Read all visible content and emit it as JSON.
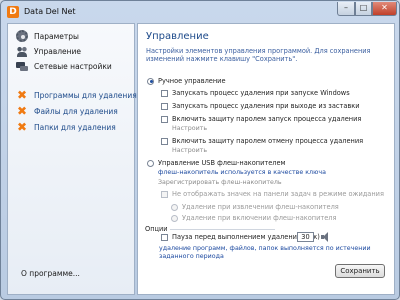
{
  "window": {
    "title": "Data Del Net",
    "app_icon": "D",
    "close_glyph": "✕",
    "max_glyph": "□",
    "min_glyph": "–"
  },
  "sidebar": {
    "items": [
      {
        "label": "Параметры",
        "icon": "gear-icon"
      },
      {
        "label": "Управление",
        "icon": "users-icon"
      },
      {
        "label": "Сетевые настройки",
        "icon": "network-icon"
      },
      {
        "label": "Программы для удаления",
        "icon": "x-icon"
      },
      {
        "label": "Файлы для удаления",
        "icon": "x-icon"
      },
      {
        "label": "Папки для удаления",
        "icon": "x-icon"
      }
    ],
    "about": "О программе...",
    "x_glyph": "✖"
  },
  "main": {
    "title": "Управление",
    "description": "Настройки элементов управления программой. Для сохранения изменений нажмите клавишу \"Сохранить\".",
    "manual": {
      "label": "Ручное управление",
      "selected": true,
      "options": [
        "Запускать процесс удаления при запуске Windows",
        "Запускать процесс удаления при выходе из заставки",
        "Включить защиту паролем запуск процесса удаления",
        "Включить защиту паролем отмену процесса удаления"
      ],
      "configure": "Настроить"
    },
    "usb": {
      "label": "Управление USB флеш-накопителем",
      "key_note": "флеш-накопитель используется в качестве ключа",
      "register": "Зарегистрировать флеш-накопитель",
      "hide_icon": "Не отображать значек на панели задач в режиме ожидания",
      "on_remove": "Удаление при извлечении флеш-накопителя",
      "on_insert": "Удаление при включении флеш-накопителя"
    },
    "options_group": {
      "label": "Опции",
      "delay_label": "Пауза перед выполнением удаления (сек)",
      "delay_value": "30",
      "note": "удаление программ, файлов, папок выполняется по истечении заданного периода"
    },
    "save_button": "Сохранить"
  },
  "colors": {
    "accent": "#1d4a8a",
    "orange": "#f07a12",
    "link": "#1d4aa0"
  }
}
